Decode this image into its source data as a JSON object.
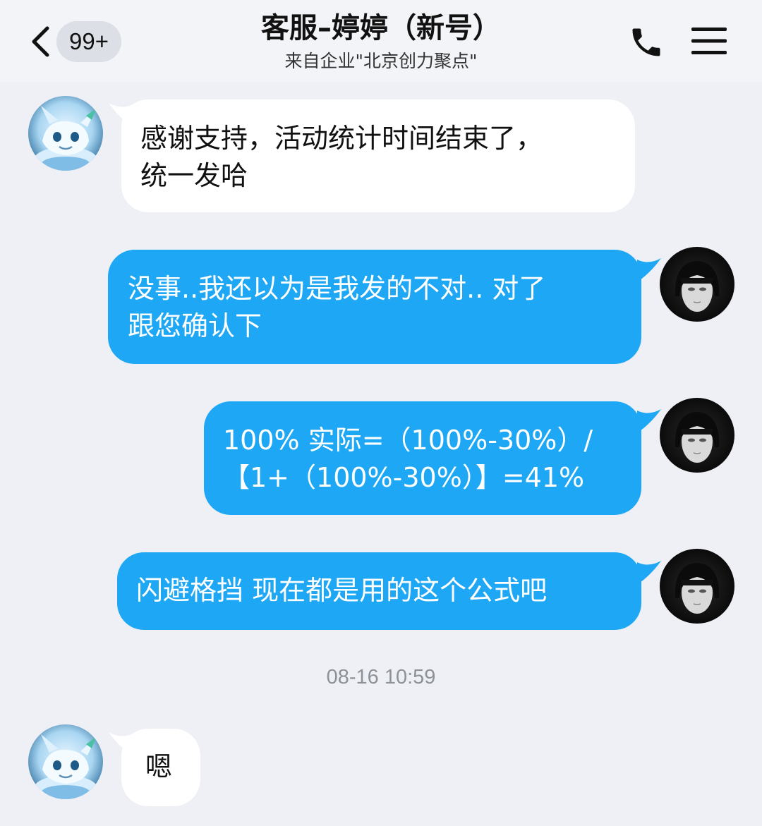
{
  "header": {
    "back_badge": "99+",
    "title": "客服–婷婷（新号）",
    "subtitle": "来自企业\"北京创力聚点\""
  },
  "icons": [
    "back-arrow-icon",
    "phone-icon",
    "menu-icon"
  ],
  "colors": {
    "outgoing_bubble": "#1ea7f4",
    "incoming_bubble": "#ffffff",
    "background": "#eef0f5"
  },
  "messages": [
    {
      "direction": "in",
      "lines": [
        "感谢支持，活动统计时间结束了，",
        "统一发哈"
      ]
    },
    {
      "direction": "out",
      "lines": [
        "没事..我还以为是我发的不对.. 对了",
        "跟您确认下"
      ]
    },
    {
      "direction": "out",
      "lines": [
        "100% 实际=（100%-30%）/",
        "【1+（100%-30%）】=41%"
      ]
    },
    {
      "direction": "out",
      "lines": [
        "闪避格挡 现在都是用的这个公式吧"
      ]
    },
    {
      "direction": "in",
      "lines": [
        "嗯"
      ]
    }
  ],
  "timestamp": "08-16 10:59"
}
